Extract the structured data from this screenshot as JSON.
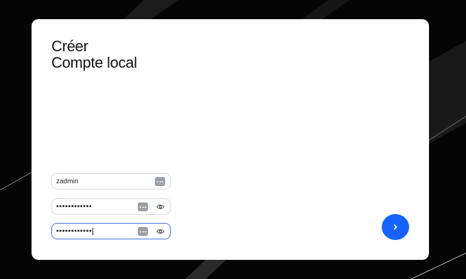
{
  "title": {
    "line1": "Créer",
    "line2": "Compte local"
  },
  "fields": {
    "username": {
      "value": "zadmin"
    },
    "password": {
      "value": "••••••••••••"
    },
    "confirm": {
      "value": "••••••••••••"
    }
  },
  "icons": {
    "password_manager": "password-manager-key-icon",
    "show_password": "eye-icon",
    "next": "chevron-right-icon"
  },
  "colors": {
    "accent": "#1463ff",
    "focus_border": "#3f6fe0"
  }
}
